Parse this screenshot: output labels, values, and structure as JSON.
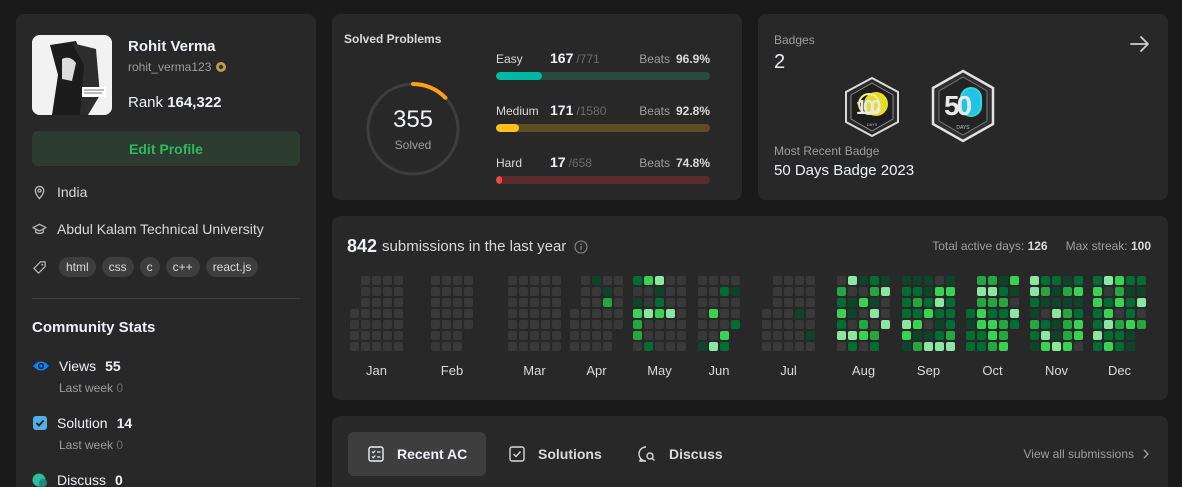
{
  "profile": {
    "name": "Rohit Verma",
    "username": "rohit_verma123",
    "rank_label": "Rank",
    "rank_value": "164,322",
    "edit_label": "Edit Profile",
    "location": "India",
    "university": "Abdul Kalam Technical University",
    "skills": [
      "html",
      "css",
      "c",
      "c++",
      "react.js"
    ]
  },
  "community": {
    "title": "Community Stats",
    "views_label": "Views",
    "views_value": "55",
    "views_last_label": "Last week",
    "views_last_value": "0",
    "solution_label": "Solution",
    "solution_value": "14",
    "solution_last_label": "Last week",
    "solution_last_value": "0",
    "discuss_label": "Discuss",
    "discuss_value": "0"
  },
  "solved": {
    "title": "Solved Problems",
    "total": "355",
    "total_label": "Solved",
    "progress_fraction": 0.1277,
    "beats_label": "Beats",
    "difficulties": [
      {
        "label": "Easy",
        "solved": "167",
        "total": "/771",
        "beats": "96.9%",
        "fraction": 0.2166,
        "color": "#00b8a3",
        "track": "#2a4a40"
      },
      {
        "label": "Medium",
        "solved": "171",
        "total": "/1580",
        "beats": "92.8%",
        "fraction": 0.1082,
        "color": "#ffc01e",
        "track": "#5e4e1e"
      },
      {
        "label": "Hard",
        "solved": "17",
        "total": "/658",
        "beats": "74.8%",
        "fraction": 0.0258,
        "color": "#ef4743",
        "track": "#5a2c2c"
      }
    ]
  },
  "badges": {
    "label": "Badges",
    "count": "2",
    "recent_label": "Most Recent Badge",
    "recent_name": "50 Days Badge 2023",
    "badge1_text": "100",
    "badge2_text": "50",
    "badge_sub": "DAYS"
  },
  "submissions": {
    "count": "842",
    "text": "submissions in the last year",
    "active_days_label": "Total active days:",
    "active_days": "126",
    "max_streak_label": "Max streak:",
    "max_streak": "100",
    "months": [
      "Jan",
      "Feb",
      "Mar",
      "Apr",
      "May",
      "Jun",
      "Jul",
      "Aug",
      "Sep",
      "Oct",
      "Nov",
      "Dec"
    ],
    "colors": {
      "empty": "#393939",
      "l1": "#0e4429",
      "l2": "#006d32",
      "l3": "#26a641",
      "l4": "#39d353",
      "l5": "#8ae6a0"
    }
  },
  "recent": {
    "tabs": [
      "Recent AC",
      "Solutions",
      "Discuss"
    ],
    "view_all": "View all submissions"
  }
}
